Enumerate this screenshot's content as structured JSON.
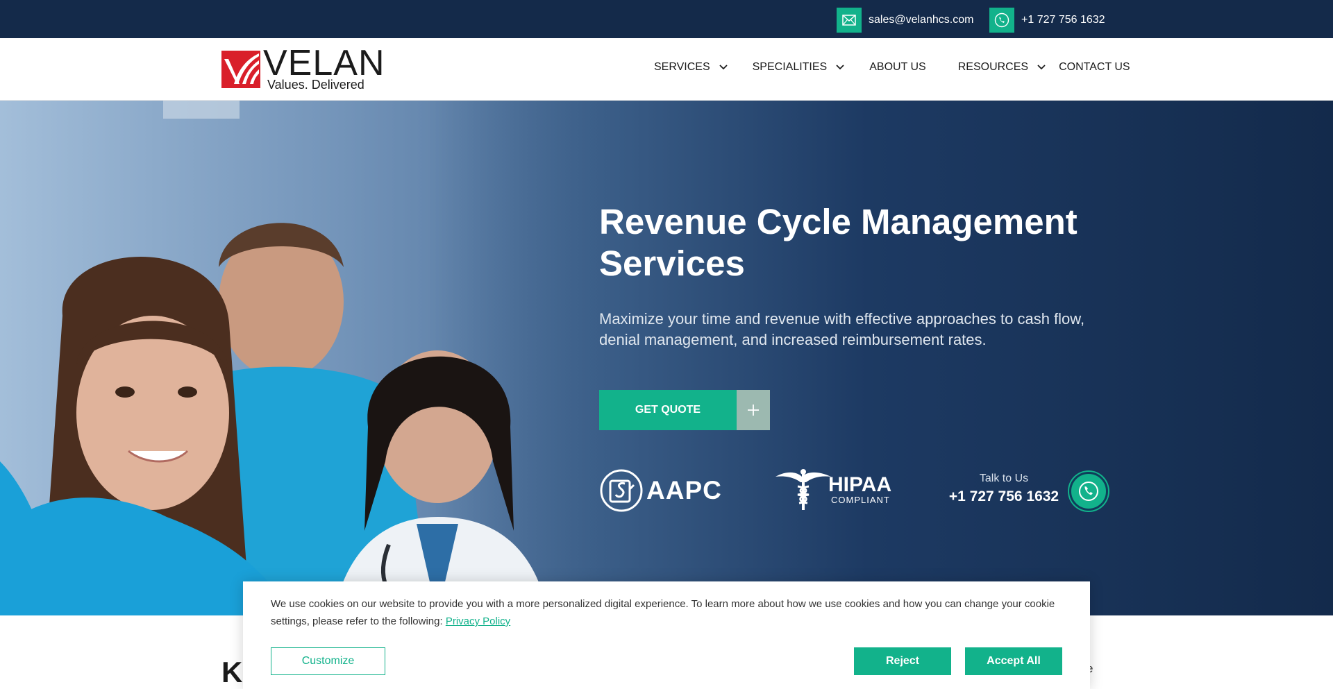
{
  "topbar": {
    "email": "sales@velanhcs.com",
    "phone": "+1 727 756 1632",
    "email_icon": "envelope-icon",
    "phone_icon": "phone-icon"
  },
  "brand": {
    "name": "VELAN",
    "tagline": "Values. Delivered",
    "color_red": "#d91f2a"
  },
  "nav": {
    "items": [
      {
        "label": "SERVICES",
        "has_dropdown": true
      },
      {
        "label": "SPECIALITIES",
        "has_dropdown": true
      },
      {
        "label": "ABOUT US",
        "has_dropdown": false
      },
      {
        "label": "RESOURCES",
        "has_dropdown": true
      },
      {
        "label": "CONTACT US",
        "has_dropdown": false
      }
    ]
  },
  "hero": {
    "title": "Revenue Cycle Management Services",
    "subtitle": "Maximize your time and revenue with effective approaches to cash flow, denial management, and increased reimbursement rates.",
    "cta_label": "GET QUOTE",
    "badges": {
      "aapc": "AAPC",
      "hipaa": "HIPAA",
      "hipaa_sub": "COMPLIANT"
    },
    "talk_label": "Talk to Us",
    "talk_phone": "+1 727 756 1632"
  },
  "below": {
    "heading_partial": "Ke",
    "right_partial": "e"
  },
  "cookie": {
    "message": "We use cookies on our website to provide you with a more personalized digital experience. To learn more about how we use cookies and how you can change your cookie settings, please refer to the following: ",
    "link_label": "Privacy Policy",
    "customize_label": "Customize",
    "reject_label": "Reject",
    "accept_label": "Accept All"
  },
  "colors": {
    "accent": "#12b28b",
    "navy": "#142a4a"
  }
}
